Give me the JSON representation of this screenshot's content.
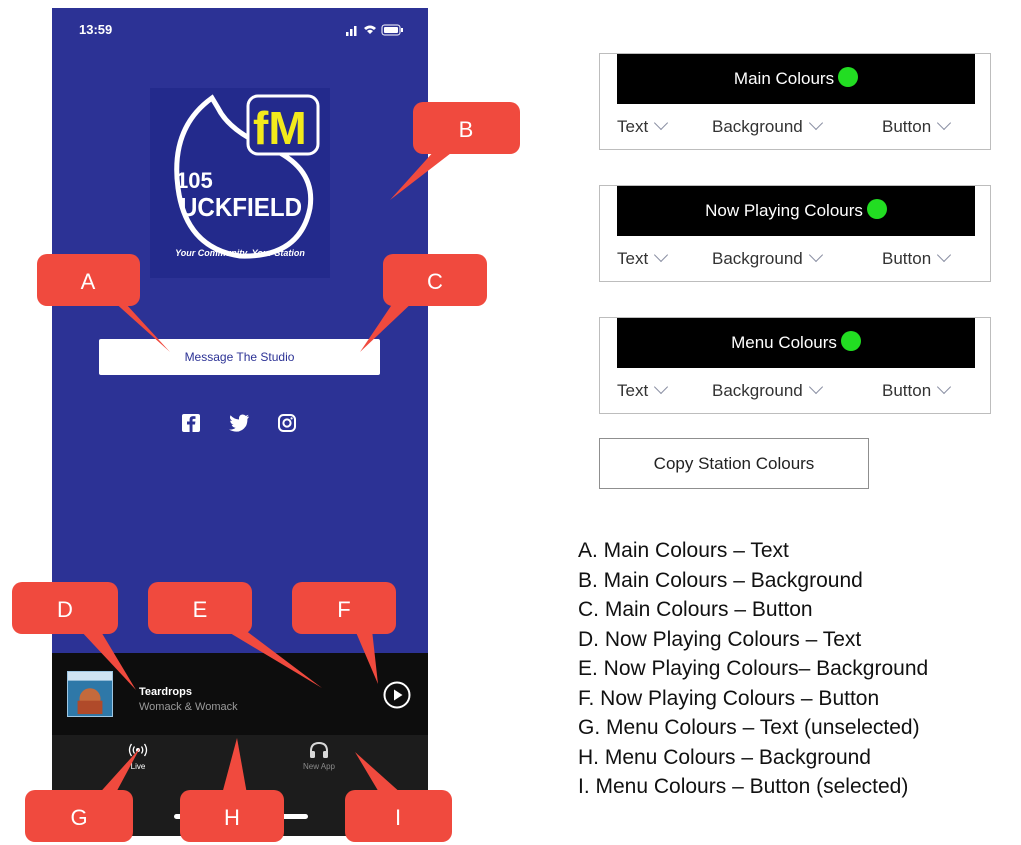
{
  "phone": {
    "time": "13:59",
    "logo_text_fm": "fM",
    "logo_text_105": "105",
    "logo_text_name": "UCKFIELD",
    "tagline": "Your Community, Your Station",
    "message_button": "Message The Studio",
    "social": [
      "facebook-icon",
      "twitter-icon",
      "instagram-icon"
    ],
    "now_playing": {
      "title": "Teardrops",
      "artist": "Womack & Womack"
    },
    "tabs": [
      {
        "label": "Live",
        "icon": "broadcast-icon"
      },
      {
        "label": "New App",
        "icon": "headphones-icon"
      }
    ],
    "colors": {
      "background": "#2c3295",
      "now_playing_bg": "#0d0d0d",
      "menu_bg": "#1c1c1c",
      "logo_accent": "#f2ea1c"
    }
  },
  "callouts": [
    "A",
    "B",
    "C",
    "D",
    "E",
    "F",
    "G",
    "H",
    "I"
  ],
  "panels": [
    {
      "title": "Main Colours",
      "text": "Text",
      "background": "Background",
      "button": "Button"
    },
    {
      "title": "Now Playing Colours",
      "text": "Text",
      "background": "Background",
      "button": "Button"
    },
    {
      "title": "Menu Colours",
      "text": "Text",
      "background": "Background",
      "button": "Button"
    }
  ],
  "copy_button": "Copy Station Colours",
  "legend": [
    "A. Main Colours – Text",
    "B. Main Colours – Background",
    "C. Main Colours – Button",
    "D. Now Playing Colours – Text",
    "E. Now Playing Colours– Background",
    "F. Now Playing Colours – Button",
    "G. Menu Colours – Text (unselected)",
    "H. Menu Colours – Background",
    "I. Menu Colours – Button (selected)"
  ],
  "accent_colors": {
    "callout": "#f04a3e",
    "status_dot": "#22dd22"
  }
}
